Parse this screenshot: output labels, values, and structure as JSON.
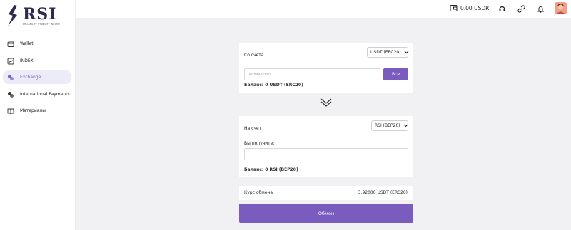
{
  "sidebar": {
    "logo": {
      "name": "RSI",
      "tagline": "RELIABILITY STABILITY INCOME"
    },
    "items": [
      {
        "label": "Wallet",
        "icon": "wallet-icon"
      },
      {
        "label": "INDEX",
        "icon": "chart-icon"
      },
      {
        "label": "Exchange",
        "icon": "exchange-icon",
        "active": true
      },
      {
        "label": "International Payments",
        "icon": "coins-icon"
      },
      {
        "label": "Материалы",
        "icon": "book-icon"
      }
    ]
  },
  "header": {
    "balance": "0.00 USDR",
    "icons": [
      "wallet-icon",
      "headset-icon",
      "link-icon",
      "bell-icon",
      "avatar"
    ]
  },
  "from": {
    "label": "Со счета",
    "currency": "USDT (ERC20)",
    "amount_placeholder": "количество",
    "all_button": "Все",
    "balance": "Баланс: 0 USDT (ERC20)"
  },
  "to": {
    "label": "На счет",
    "currency": "RSI (BEP20)",
    "receive_label": "Вы получите:",
    "receive_value": "",
    "balance": "Баланс: 0 RSI (BEP20)"
  },
  "rate": {
    "label": "Курс обмена",
    "value": "3.92000 USDT (ERC20)"
  },
  "exchange_button": "Обмен",
  "colors": {
    "accent": "#7a5cbe",
    "active_bg": "#ecebf8",
    "page_bg": "#f1f1f3"
  }
}
